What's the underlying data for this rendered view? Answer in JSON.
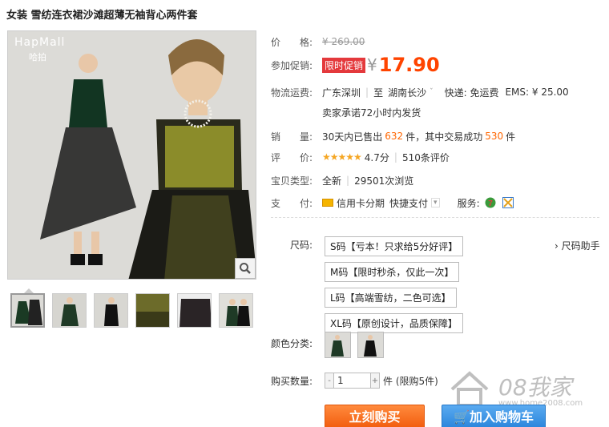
{
  "product": {
    "title": "女装 雪纺连衣裙沙滩超薄无袖背心两件套",
    "brand": "HapMall",
    "brand_sub": "哈拍"
  },
  "price": {
    "label": "价　　格:",
    "original": "¥ 269.00",
    "promo_label": "参加促销:",
    "promo_tag": "限时促销",
    "yen": "¥",
    "current": "17.90"
  },
  "logistics": {
    "label": "物流运费:",
    "from": "广东深圳",
    "to_prefix": "至",
    "to": "湖南长沙",
    "express": "快递: 免运费",
    "ems": "EMS: ¥ 25.00",
    "promise": "卖家承诺72小时内发货"
  },
  "sales": {
    "label": "销　　量:",
    "text1": "30天内已售出",
    "sold": "632",
    "text2": "件，其中交易成功",
    "success": "530",
    "text3": "件"
  },
  "rating": {
    "label": "评　　价:",
    "stars": "★★★★★",
    "score": "4.7分",
    "count": "510条评价"
  },
  "item_type": {
    "label": "宝贝类型:",
    "condition": "全新",
    "views": "29501次浏览"
  },
  "payment": {
    "label": "支　　付:",
    "installment": "信用卡分期",
    "quick": "快捷支付",
    "services_label": "服务:",
    "svc_seven": "7"
  },
  "size": {
    "label": "尺码:",
    "options": [
      "S码【亏本！只求给5分好评】",
      "M码【限时秒杀，仅此一次】",
      "L码【高端雪纺，二色可选】",
      "XL码【原创设计，品质保障】"
    ],
    "help": "› 尺码助手"
  },
  "color": {
    "label": "颜色分类:"
  },
  "quantity": {
    "label": "购买数量:",
    "minus": "-",
    "value": "1",
    "plus": "+",
    "after": "件 (限购5件)"
  },
  "actions": {
    "buy": "立刻购买",
    "cart": "加入购物车"
  },
  "watermark": {
    "text": "08我家",
    "url": "www.home2008.com"
  },
  "colors": {
    "accent": "#ff4400",
    "promo": "#e4393c",
    "buy": "#f25d0e",
    "cart": "#2b86dc",
    "dress_green": "#1f3a26",
    "dress_yellow": "#8b8c2a"
  }
}
